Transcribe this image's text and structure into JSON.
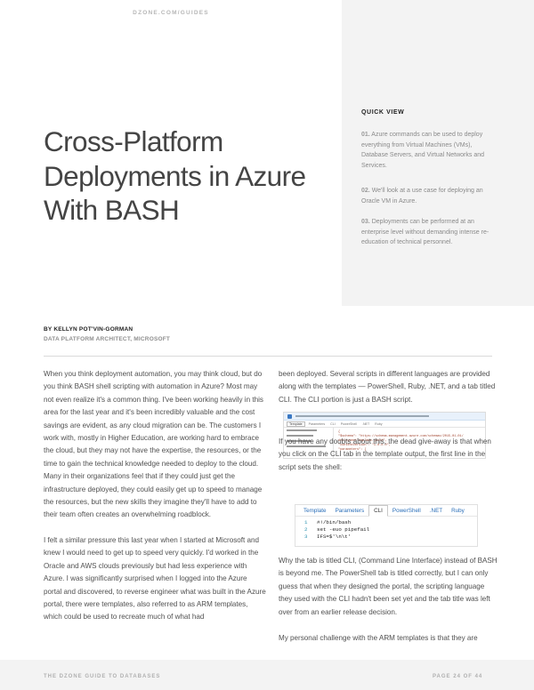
{
  "header": {
    "url": "DZONE.COM/GUIDES"
  },
  "quick_view": {
    "heading": "QUICK VIEW",
    "items": [
      {
        "num": "01.",
        "text": "Azure commands can be used to deploy everything from Virtual Machines (VMs), Database Servers, and Virtual Networks and Services."
      },
      {
        "num": "02.",
        "text": "We'll look at a use case for deploying an Oracle VM in Azure."
      },
      {
        "num": "03.",
        "text": "Deployments can be performed at an enterprise level without demanding intense re-education of technical personnel."
      }
    ]
  },
  "article": {
    "title": "Cross-Platform Deployments in Azure With BASH",
    "author": "BY KELLYN POT'VIN-GORMAN",
    "author_role": "DATA PLATFORM ARCHITECT, MICROSOFT",
    "left_p1": "When you think deployment automation, you may think cloud, but do you think BASH shell scripting with automation in Azure? Most may not even realize it's a common thing. I've been working heavily in this area for the last year and it's been incredibly valuable and the cost savings are evident, as any cloud migration can be. The customers I work with, mostly in Higher Education, are working hard to embrace the cloud, but they may not have the expertise, the resources, or the time to gain the technical knowledge needed to deploy to the cloud. Many in their organizations feel that if they could just get the infrastructure deployed, they could easily get up to speed to manage the resources, but the new skills they imagine they'll have to add to their team often creates an overwhelming roadblock.",
    "left_p2": "I felt a similar pressure this last year when I started at Microsoft and knew I would need to get up to speed very quickly. I'd worked in the Oracle and AWS clouds previously but had less experience with Azure. I was significantly surprised when I logged into the Azure portal and discovered, to reverse engineer what was built in the Azure portal, there were templates, also referred to as ARM templates, which could be used to recreate much of what had",
    "right_p1": "been deployed. Several scripts in different languages are provided along with the templates — PowerShell, Ruby, .NET, and a tab titled CLI. The CLI portion is just a BASH script.",
    "right_p2": "If you have any doubts about this, the dead give-away is that when you click on the CLI tab in the template output, the first line in the script sets the shell:",
    "right_p3": "Why the tab is titled CLI, (Command Line Interface) instead of BASH is beyond me. The PowerShell tab is titled correctly, but I can only guess that when they designed the portal, the scripting language they used with the CLI hadn't been set yet and the tab title was left over from an earlier release decision.",
    "right_p4": "My personal challenge with the ARM templates is that they are"
  },
  "portal_screenshot": {
    "tabs": [
      "Template",
      "Parameters",
      "CLI",
      "PowerShell",
      ".NET",
      "Ruby"
    ],
    "code_lines": [
      "{",
      "  \"$schema\": \"https://schema.management.azure.com/schemas/2015-01-01/",
      "  deploymentTemplate.json#\",",
      "  \"contentVersion\": \"1.0.0.0\",",
      "  \"parameters\": {"
    ]
  },
  "cli_screenshot": {
    "tabs": [
      "Template",
      "Parameters",
      "CLI",
      "PowerShell",
      ".NET",
      "Ruby"
    ],
    "active_tab": "CLI",
    "lines": [
      {
        "n": "1",
        "code": "#!/bin/bash"
      },
      {
        "n": "2",
        "code": "set -euo pipefail"
      },
      {
        "n": "3",
        "code": "IFS=$'\\n\\t'"
      }
    ]
  },
  "footer": {
    "left": "THE DZONE GUIDE TO DATABASES",
    "right": "PAGE 24 OF 44"
  }
}
